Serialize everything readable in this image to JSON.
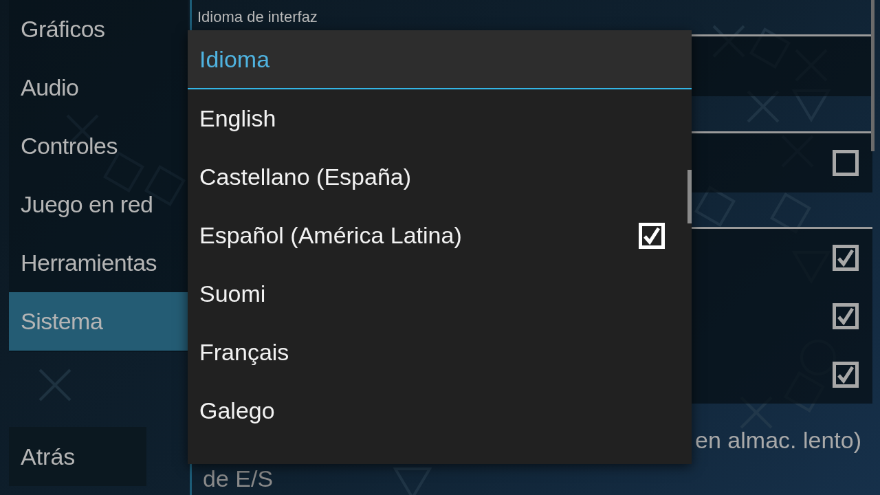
{
  "sidebar": {
    "items": [
      {
        "label": "Gráficos",
        "selected": false
      },
      {
        "label": "Audio",
        "selected": false
      },
      {
        "label": "Controles",
        "selected": false
      },
      {
        "label": "Juego en red",
        "selected": false
      },
      {
        "label": "Herramientas",
        "selected": false
      },
      {
        "label": "Sistema",
        "selected": true
      }
    ],
    "back_button": "Atrás"
  },
  "settings": {
    "section_label": "Idioma de interfaz",
    "rows": [
      {
        "kind": "blank"
      },
      {
        "kind": "checkbox",
        "checked": false
      },
      {
        "kind": "checkbox",
        "checked": true
      },
      {
        "kind": "checkbox",
        "checked": true
      },
      {
        "kind": "checkbox",
        "checked": true
      },
      {
        "kind": "text",
        "title": "de E/S",
        "value": "en almac. lento)"
      }
    ]
  },
  "dialog": {
    "title": "Idioma",
    "options": [
      {
        "label": "English",
        "selected": false
      },
      {
        "label": "Castellano (España)",
        "selected": false
      },
      {
        "label": "Español (América Latina)",
        "selected": true
      },
      {
        "label": "Suomi",
        "selected": false
      },
      {
        "label": "Français",
        "selected": false
      },
      {
        "label": "Galego",
        "selected": false
      }
    ]
  }
}
